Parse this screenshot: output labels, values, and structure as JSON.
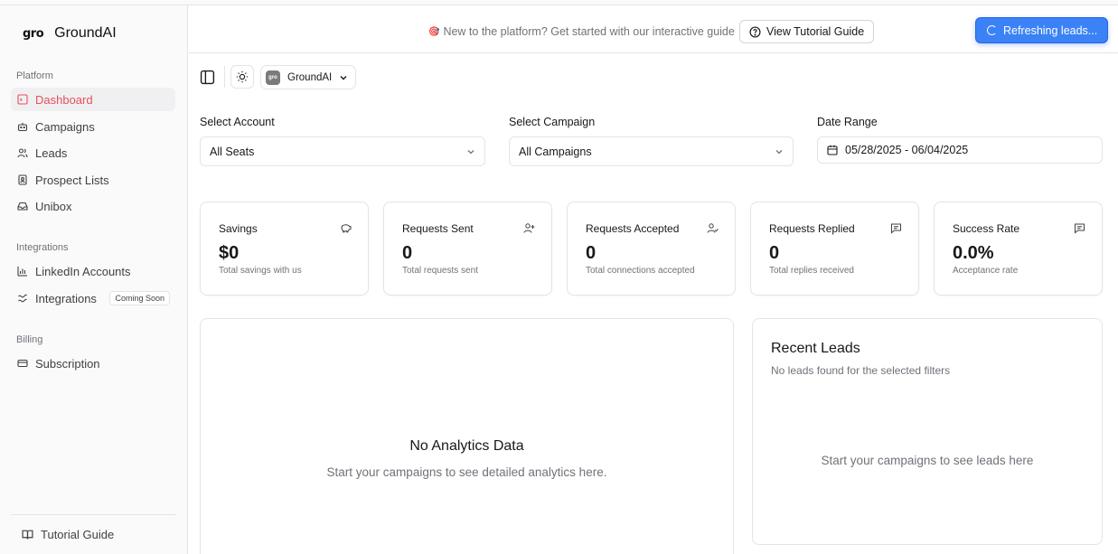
{
  "brand": {
    "logo_text": "gro",
    "name": "GroundAI"
  },
  "sidebar": {
    "platform_label": "Platform",
    "platform_items": [
      {
        "label": "Dashboard",
        "icon": "dashboard-icon",
        "active": true
      },
      {
        "label": "Campaigns",
        "icon": "bot-icon"
      },
      {
        "label": "Leads",
        "icon": "users-icon"
      },
      {
        "label": "Prospect Lists",
        "icon": "contact-list-icon"
      },
      {
        "label": "Unibox",
        "icon": "inbox-icon"
      }
    ],
    "integrations_label": "Integrations",
    "integrations_items": [
      {
        "label": "LinkedIn Accounts",
        "icon": "chart-icon"
      },
      {
        "label": "Integrations",
        "icon": "workflow-icon",
        "badge": "Coming Soon"
      }
    ],
    "billing_label": "Billing",
    "billing_items": [
      {
        "label": "Subscription",
        "icon": "credit-card-icon"
      }
    ],
    "footer_link": "Tutorial Guide"
  },
  "banner": {
    "emoji": "🎯",
    "text": "New to the platform? Get started with our interactive guide",
    "button_label": "View Tutorial Guide"
  },
  "toast": {
    "text": "Refreshing leads..."
  },
  "toolbar": {
    "org_name": "GroundAI",
    "org_avatar_text": "gro"
  },
  "filters": {
    "account_label": "Select Account",
    "account_value": "All Seats",
    "campaign_label": "Select Campaign",
    "campaign_value": "All Campaigns",
    "date_label": "Date Range",
    "date_value": "05/28/2025 - 06/04/2025"
  },
  "stats": [
    {
      "title": "Savings",
      "value": "$0",
      "sub": "Total savings with us",
      "icon": "piggy-bank-icon"
    },
    {
      "title": "Requests Sent",
      "value": "0",
      "sub": "Total requests sent",
      "icon": "user-plus-icon"
    },
    {
      "title": "Requests Accepted",
      "value": "0",
      "sub": "Total connections accepted",
      "icon": "user-check-icon"
    },
    {
      "title": "Requests Replied",
      "value": "0",
      "sub": "Total replies received",
      "icon": "message-icon"
    },
    {
      "title": "Success Rate",
      "value": "0.0%",
      "sub": "Acceptance rate",
      "icon": "message-icon"
    }
  ],
  "analytics": {
    "title": "No Analytics Data",
    "subtitle": "Start your campaigns to see detailed analytics here."
  },
  "recent_leads": {
    "title": "Recent Leads",
    "subtitle": "No leads found for the selected filters",
    "empty_text": "Start your campaigns to see leads here"
  },
  "colors": {
    "accent_active": "#e8505b",
    "toast_blue": "#3b82f6"
  }
}
